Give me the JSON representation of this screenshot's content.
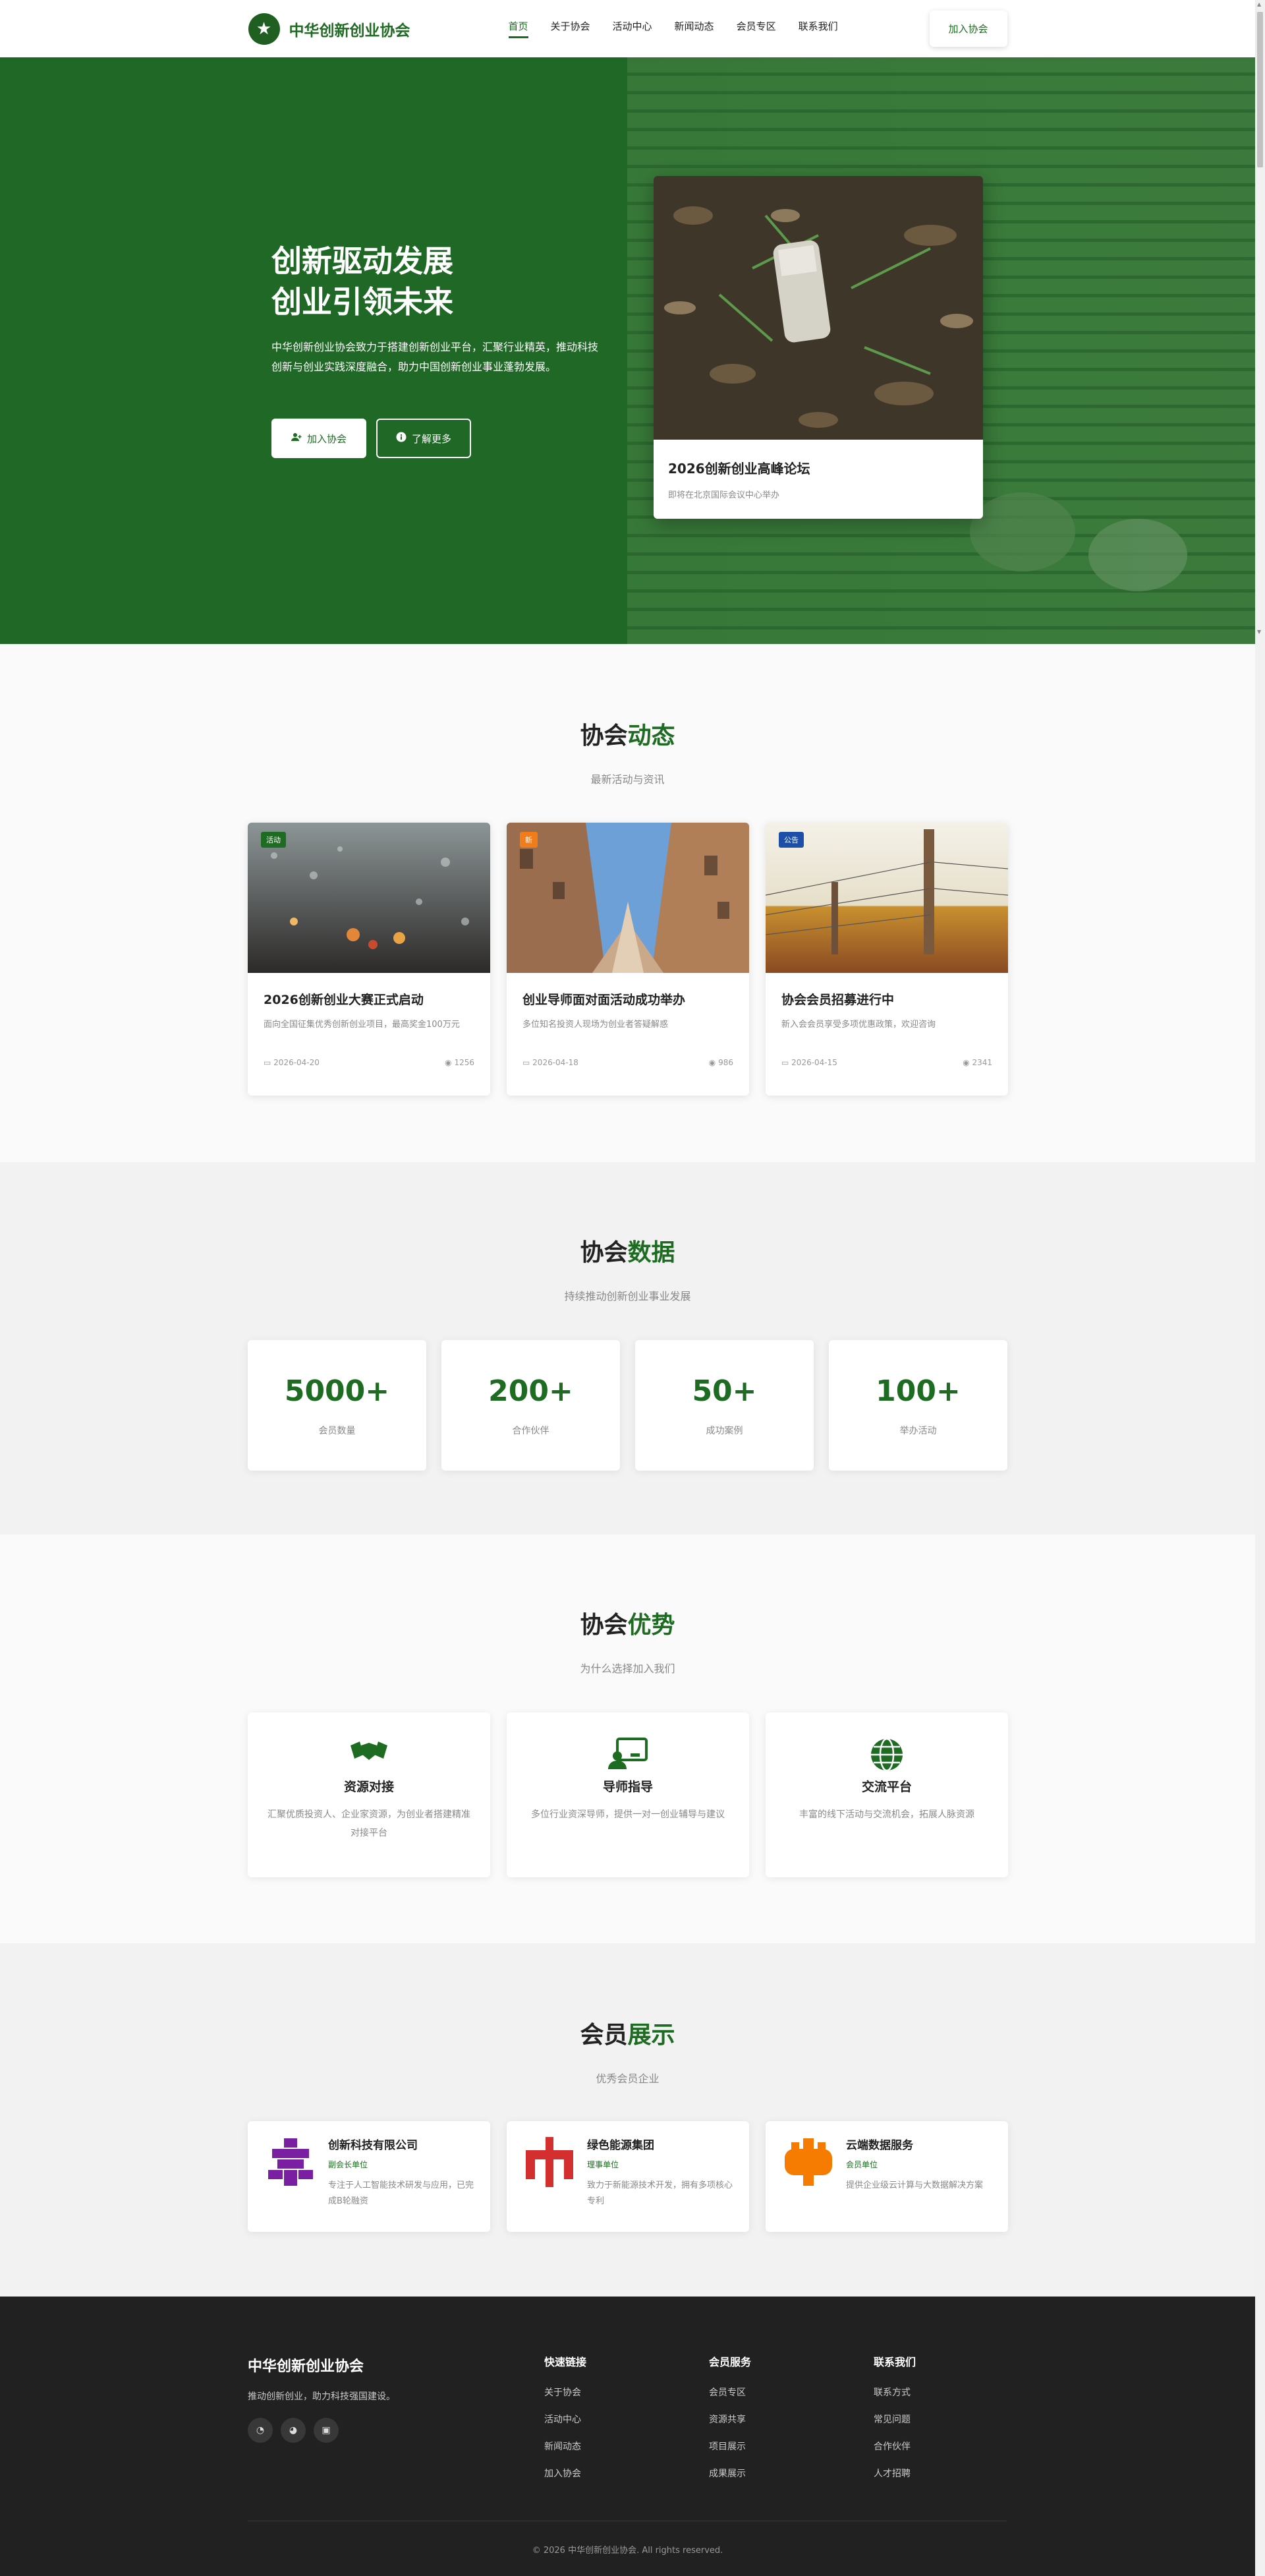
{
  "brand": {
    "name": "中华创新创业协会",
    "logo_icon": "star-icon",
    "primary_color": "#1e6b22"
  },
  "nav": {
    "items": [
      "首页",
      "关于协会",
      "活动中心",
      "新闻动态",
      "会员专区",
      "联系我们"
    ],
    "active": "首页",
    "cta": "加入协会"
  },
  "hero": {
    "title_line1": "创新驱动发展",
    "title_line2": "创业引领未来",
    "description": "中华创新创业协会致力于搭建创新创业平台，汇聚行业精英，推动科技创新与创业实践深度融合，助力中国创新创业事业蓬勃发展。",
    "primary_button": "加入协会",
    "secondary_button": "了解更多",
    "card_title": "2026创新创业高峰论坛",
    "card_subtitle": "即将在北京国际会议中心举办"
  },
  "news": {
    "title_prefix": "协会",
    "title_accent": "动态",
    "subtitle": "最新活动与资讯",
    "items": [
      {
        "tag": "活动",
        "tag_color": "#1e6b22",
        "title": "2026创新创业大赛正式启动",
        "desc": "面向全国征集优秀创新创业项目，最高奖金100万元",
        "date": "2026-04-20",
        "views": "1256"
      },
      {
        "tag": "新",
        "tag_color": "#f07c1a",
        "title": "创业导师面对面活动成功举办",
        "desc": "多位知名投资人现场为创业者答疑解惑",
        "date": "2026-04-18",
        "views": "986"
      },
      {
        "tag": "公告",
        "tag_color": "#1e4fa8",
        "title": "协会会员招募进行中",
        "desc": "新入会会员享受多项优惠政策，欢迎咨询",
        "date": "2026-04-15",
        "views": "2341"
      }
    ]
  },
  "stats": {
    "title_prefix": "协会",
    "title_accent": "数据",
    "subtitle": "持续推动创新创业事业发展",
    "items": [
      {
        "value": "5000+",
        "label": "会员数量"
      },
      {
        "value": "200+",
        "label": "合作伙伴"
      },
      {
        "value": "50+",
        "label": "成功案例"
      },
      {
        "value": "100+",
        "label": "举办活动"
      }
    ]
  },
  "advantages": {
    "title_prefix": "协会",
    "title_accent": "优势",
    "subtitle": "为什么选择加入我们",
    "items": [
      {
        "icon": "handshake-icon",
        "title": "资源对接",
        "desc": "汇聚优质投资人、企业家资源，为创业者搭建精准对接平台"
      },
      {
        "icon": "mentor-icon",
        "title": "导师指导",
        "desc": "多位行业资深导师，提供一对一创业辅导与建议"
      },
      {
        "icon": "globe-icon",
        "title": "交流平台",
        "desc": "丰富的线下活动与交流机会，拓展人脉资源"
      }
    ]
  },
  "members": {
    "title_prefix": "会员",
    "title_accent": "展示",
    "subtitle": "优秀会员企业",
    "items": [
      {
        "logo_color": "#7b1fa2",
        "name": "创新科技有限公司",
        "role": "副会长单位",
        "desc": "专注于人工智能技术研发与应用，已完成B轮融资"
      },
      {
        "logo_color": "#d32f2f",
        "name": "绿色能源集团",
        "role": "理事单位",
        "desc": "致力于新能源技术开发，拥有多项核心专利"
      },
      {
        "logo_color": "#f57c00",
        "name": "云端数据服务",
        "role": "会员单位",
        "desc": "提供企业级云计算与大数据解决方案"
      }
    ]
  },
  "footer": {
    "title": "中华创新创业协会",
    "slogan": "推动创新创业，助力科技强国建设。",
    "social": [
      "weibo-icon",
      "wechat-icon",
      "linkedin-icon"
    ],
    "columns": [
      {
        "heading": "快速链接",
        "links": [
          "关于协会",
          "活动中心",
          "新闻动态",
          "加入协会"
        ]
      },
      {
        "heading": "会员服务",
        "links": [
          "会员专区",
          "资源共享",
          "项目展示",
          "成果展示"
        ]
      },
      {
        "heading": "联系我们",
        "links": [
          "联系方式",
          "常见问题",
          "合作伙伴",
          "人才招聘"
        ]
      }
    ],
    "copyright": "© 2026 中华创新创业协会. All rights reserved."
  }
}
